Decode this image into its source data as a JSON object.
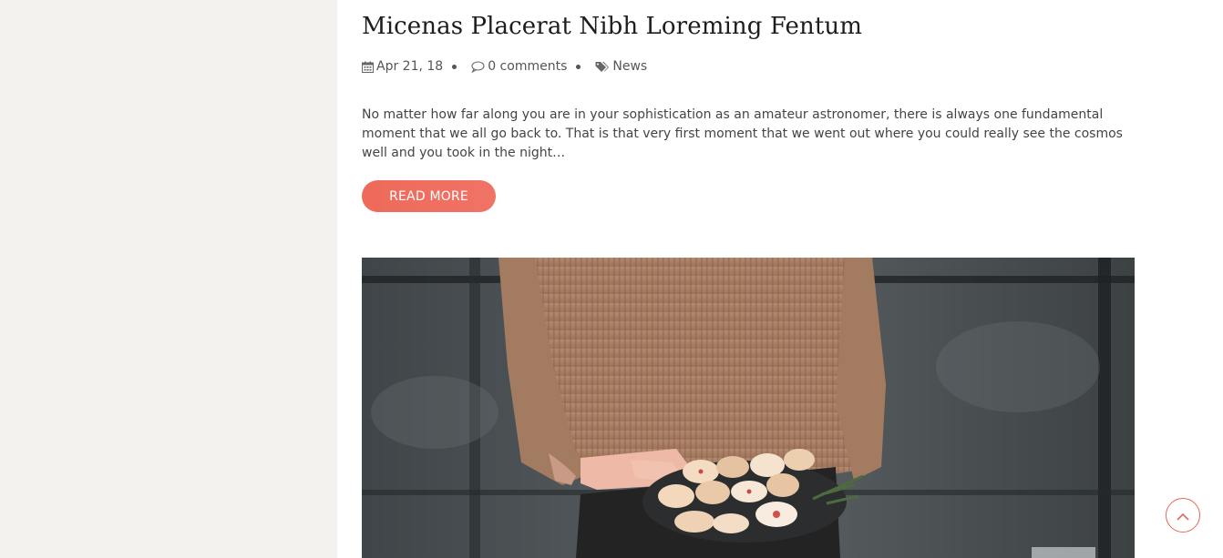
{
  "post": {
    "title": "Micenas Placerat Nibh Loreming Fentum",
    "meta": {
      "date": "Apr 21, 18",
      "comments": "0 comments",
      "category": "News"
    },
    "excerpt": "No matter how far along you are in your sophistication as an amateur astronomer, there is always one fundamental moment that we all go back to. That is that very first moment that we went out where you could really see the cosmos well and you took in the night…",
    "read_more_label": "READ MORE"
  },
  "icons": {
    "date": "calendar-icon",
    "comments": "comment-icon",
    "category": "tags-icon",
    "scroll_top": "chevron-up-icon"
  },
  "colors": {
    "accent": "#ee6a5a",
    "sidebar_bg": "#f3f2ee",
    "title": "#1d1d1d",
    "text": "#444444"
  }
}
